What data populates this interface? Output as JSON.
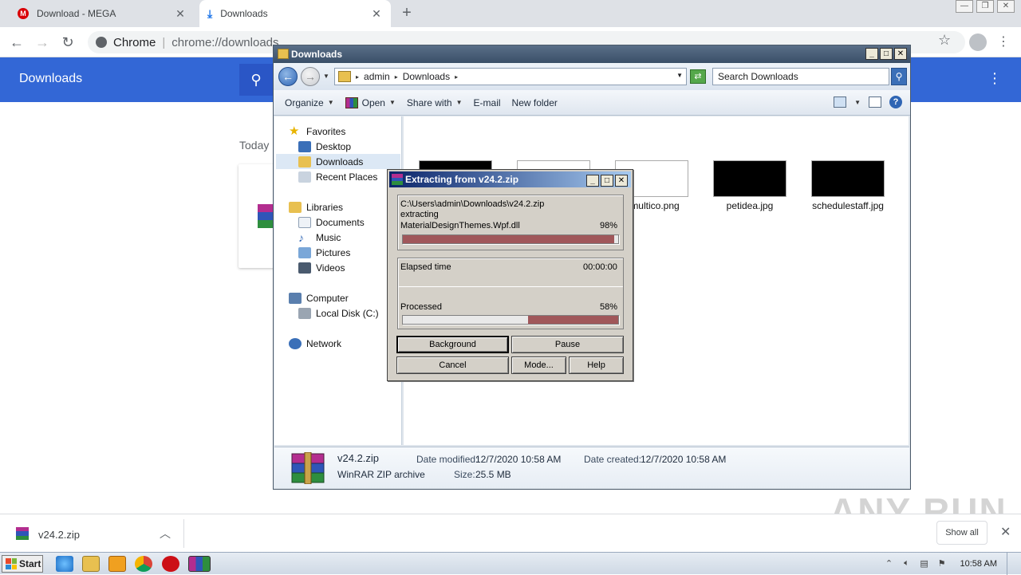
{
  "chrome": {
    "tabs": [
      {
        "title": "Download - MEGA"
      },
      {
        "title": "Downloads"
      }
    ],
    "omnibox": {
      "site": "Chrome",
      "url": "chrome://downloads"
    },
    "downloads_page": {
      "title": "Downloads",
      "section": "Today"
    },
    "download_bar": {
      "file": "v24.2.zip",
      "show_all": "Show all"
    }
  },
  "explorer": {
    "title": "Downloads",
    "breadcrumb": [
      "admin",
      "Downloads"
    ],
    "search_placeholder": "Search Downloads",
    "toolbar": [
      "Organize",
      "Open",
      "Share with",
      "E-mail",
      "New folder"
    ],
    "nav": {
      "favorites": "Favorites",
      "desktop": "Desktop",
      "downloads": "Downloads",
      "recent": "Recent Places",
      "libraries": "Libraries",
      "documents": "Documents",
      "music": "Music",
      "pictures": "Pictures",
      "videos": "Videos",
      "computer": "Computer",
      "localdisk": "Local Disk (C:)",
      "network": "Network"
    },
    "files": [
      "multico.png",
      "petidea.jpg",
      "schedulestaff.jpg"
    ],
    "details": {
      "name": "v24.2.zip",
      "type": "WinRAR ZIP archive",
      "modified_label": "Date modified:",
      "modified": "12/7/2020 10:58 AM",
      "created_label": "Date created:",
      "created": "12/7/2020 10:58 AM",
      "size_label": "Size:",
      "size": "25.5 MB"
    }
  },
  "winrar": {
    "title": "Extracting from v24.2.zip",
    "path": "C:\\Users\\admin\\Downloads\\v24.2.zip",
    "action": "extracting",
    "current_file": "MaterialDesignThemes.Wpf.dll",
    "file_percent_label": "98%",
    "file_progress": 0.98,
    "elapsed_label": "Elapsed time",
    "elapsed": "00:00:00",
    "processed_label": "Processed",
    "processed_percent_label": "58%",
    "processed_progress": 0.58,
    "buttons": {
      "background": "Background",
      "pause": "Pause",
      "cancel": "Cancel",
      "mode": "Mode...",
      "help": "Help"
    }
  },
  "taskbar": {
    "start": "Start",
    "clock": "10:58 AM"
  },
  "watermark": "ANY RUN",
  "colors": {
    "chrome_header": "#3367d6",
    "rar_title": "#0a246a",
    "progress_fill": "#a0575a"
  }
}
